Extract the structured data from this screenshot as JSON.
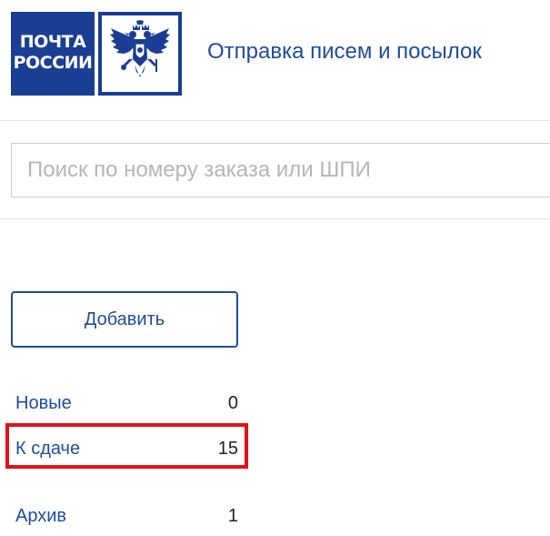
{
  "header": {
    "logo_line1": "ПОЧТА",
    "logo_line2": "РОССИИ",
    "emblem_icon": "double-headed-eagle-icon",
    "title": "Отправка писем и посылок"
  },
  "search": {
    "placeholder": "Поиск по номеру заказа или ШПИ",
    "value": ""
  },
  "actions": {
    "add_label": "Добавить"
  },
  "statuses": [
    {
      "label": "Новые",
      "count": "0"
    },
    {
      "label": "К сдаче",
      "count": "15"
    },
    {
      "label": "Архив",
      "count": "1"
    }
  ],
  "colors": {
    "brand_blue": "#1a3e93",
    "link_blue": "#1e4d9a",
    "highlight_red": "#e2101a"
  }
}
